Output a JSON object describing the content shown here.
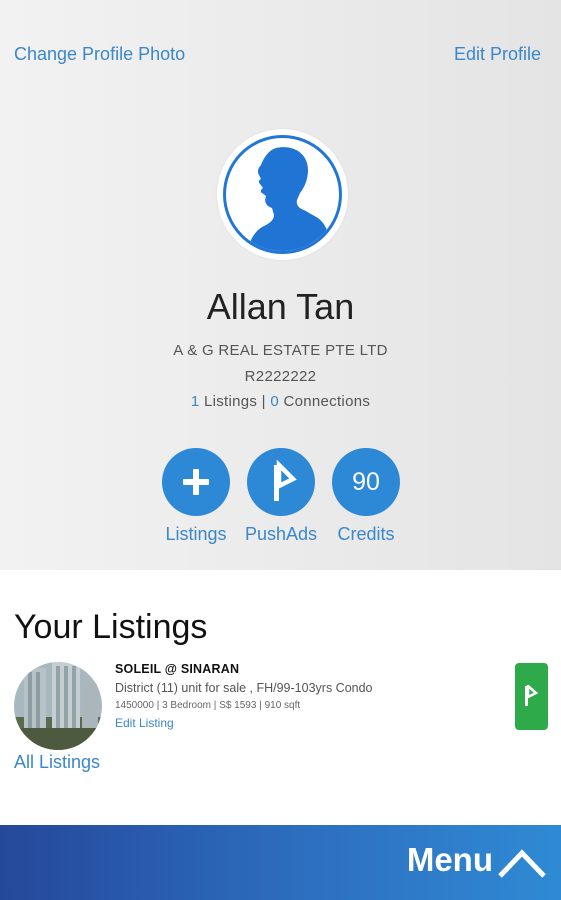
{
  "header": {
    "change_photo": "Change Profile Photo",
    "edit_profile": "Edit Profile"
  },
  "profile": {
    "name": "Allan Tan",
    "company": "A & G REAL ESTATE PTE LTD",
    "license": "R2222222",
    "listings_count": "1",
    "listings_text": " Listings | ",
    "connections_count": "0",
    "connections_text": " Connections"
  },
  "actions": {
    "listings_label": "Listings",
    "pushads_label": "PushAds",
    "credits_label": "Credits",
    "credits_value": "90"
  },
  "your_listings": {
    "title": "Your Listings",
    "items": [
      {
        "name": "SOLEIL @ SINARAN",
        "description": "District (11) unit for sale , FH/99-103yrs Condo",
        "meta": "1450000 | 3 Bedroom | S$ 1593 | 910 sqft",
        "edit_label": "Edit Listing"
      }
    ],
    "all_listings_label": "All Listings"
  },
  "menu": {
    "label": "Menu"
  },
  "colors": {
    "accent": "#2d88d6",
    "link": "#3a87c9",
    "push_green": "#2faa4a",
    "menu_gradient_start": "#25489a",
    "menu_gradient_end": "#2f8ad4"
  },
  "icons": {
    "avatar": "person-silhouette-icon",
    "add": "plus-icon",
    "pushads": "pushads-flag-icon",
    "push_listing": "pushads-flag-icon",
    "menu": "chevron-up-icon"
  }
}
